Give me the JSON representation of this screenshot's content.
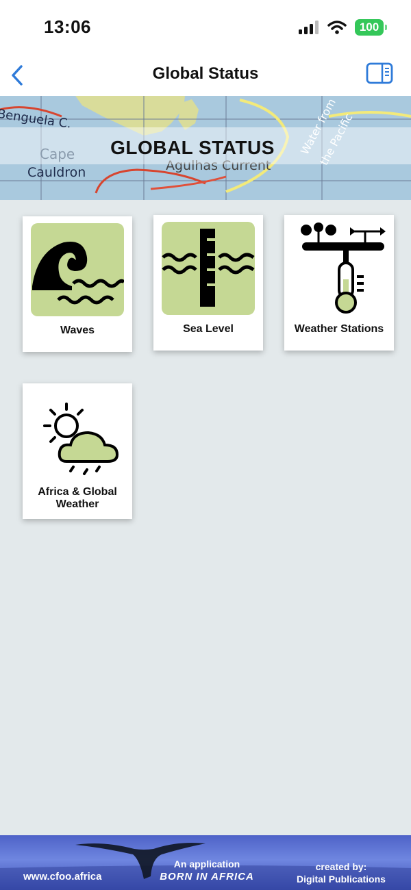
{
  "status_bar": {
    "time": "13:06",
    "battery": "100",
    "battery_color": "#34c759"
  },
  "nav": {
    "title": "Global Status",
    "back_icon": "chevron-left-icon",
    "sidebar_icon": "sidebar-toggle-icon",
    "accent": "#2f7bd9"
  },
  "banner": {
    "title": "GLOBAL STATUS",
    "map_labels": [
      "Benguela C.",
      "Cape",
      "Cauldron",
      "Agulhas Current",
      "Water from",
      "the Pacific"
    ]
  },
  "tiles": [
    {
      "label": "Waves",
      "icon": "waves-icon"
    },
    {
      "label": "Sea Level",
      "icon": "sea-level-icon"
    },
    {
      "label": "Weather Stations",
      "icon": "weather-station-icon"
    },
    {
      "label_line1": "Africa & Global",
      "label_line2": "Weather",
      "icon": "sun-cloud-rain-icon"
    }
  ],
  "footer": {
    "website": "www.cfoo.africa",
    "app_line": "An application",
    "born_line": "BORN IN AFRICA",
    "created_line1": "created by:",
    "created_line2": "Digital Publications"
  },
  "colors": {
    "page_background": "#e3e9eb",
    "icon_green": "#c5d894",
    "footer_blue": "#4e62c8"
  }
}
